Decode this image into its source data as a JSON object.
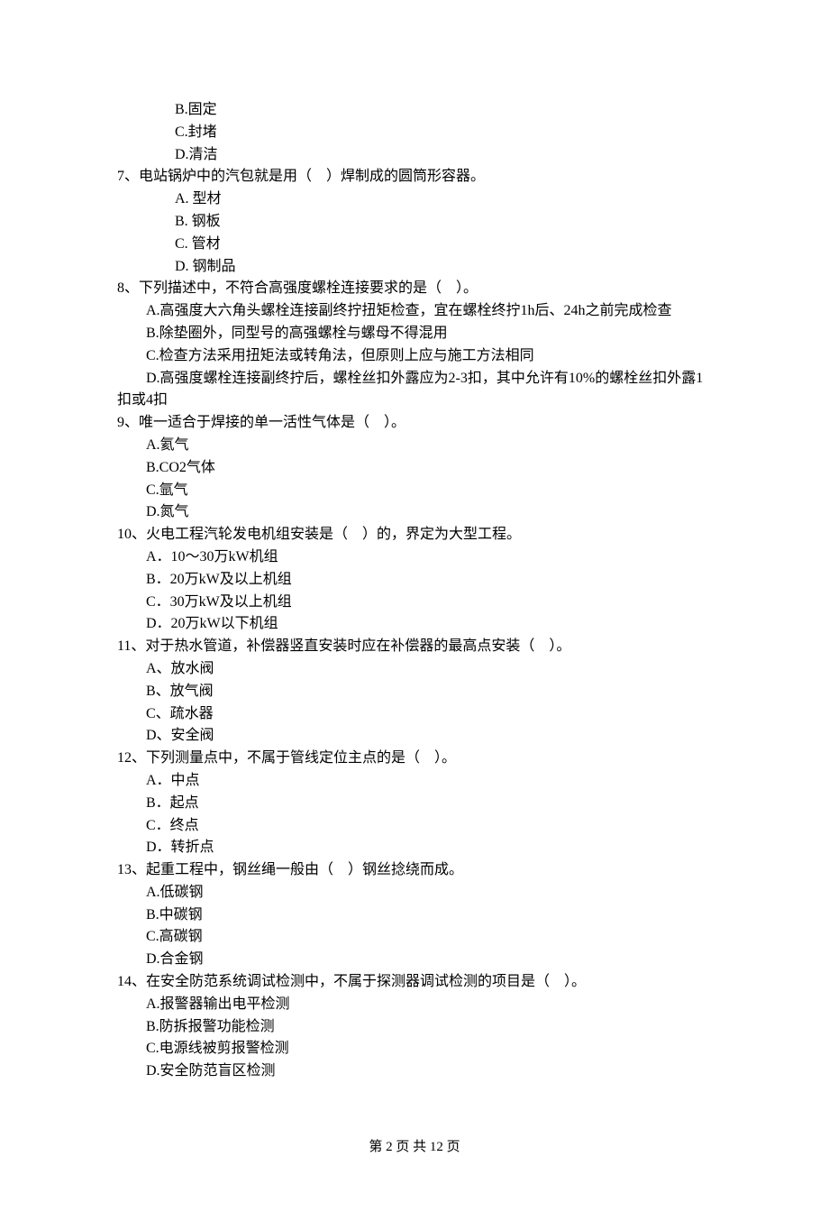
{
  "q6": {
    "opts": {
      "B": "B.固定",
      "C": "C.封堵",
      "D": "D.清洁"
    }
  },
  "q7": {
    "stem": "7、电站锅炉中的汽包就是用（    ）焊制成的圆筒形容器。",
    "opts": {
      "A": "A. 型材",
      "B": "B. 钢板",
      "C": "C. 管材",
      "D": "D. 钢制品"
    }
  },
  "q8": {
    "stem": "8、下列描述中，不符合高强度螺栓连接要求的是（    ）。",
    "opts": {
      "A": "A.高强度大六角头螺栓连接副终拧扭矩检查，宜在螺栓终拧1h后、24h之前完成检查",
      "B": "B.除垫圈外，同型号的高强螺栓与螺母不得混用",
      "C": "C.检查方法采用扭矩法或转角法，但原则上应与施工方法相同",
      "D1": "D.高强度螺栓连接副终拧后，螺栓丝扣外露应为2-3扣，其中允许有10%的螺栓丝扣外露1",
      "D2": "扣或4扣"
    }
  },
  "q9": {
    "stem": "9、唯一适合于焊接的单一活性气体是（    ）。",
    "opts": {
      "A": "A.氦气",
      "B": "B.CO2气体",
      "C": "C.氩气",
      "D": "D.氮气"
    }
  },
  "q10": {
    "stem": "10、火电工程汽轮发电机组安装是（    ）的，界定为大型工程。",
    "opts": {
      "A": "A．10～30万kW机组",
      "B": "B．20万kW及以上机组",
      "C": "C．30万kW及以上机组",
      "D": "D．20万kW以下机组"
    }
  },
  "q11": {
    "stem": "11、对于热水管道，补偿器竖直安装时应在补偿器的最高点安装（    ）。",
    "opts": {
      "A": "A、放水阀",
      "B": "B、放气阀",
      "C": "C、疏水器",
      "D": "D、安全阀"
    }
  },
  "q12": {
    "stem": "12、下列测量点中，不属于管线定位主点的是（    ）。",
    "opts": {
      "A": "A．中点",
      "B": "B．起点",
      "C": "C．终点",
      "D": "D．转折点"
    }
  },
  "q13": {
    "stem": "13、起重工程中，钢丝绳一般由（    ）钢丝捻绕而成。",
    "opts": {
      "A": "A.低碳钢",
      "B": "B.中碳钢",
      "C": "C.高碳钢",
      "D": "D.合金钢"
    }
  },
  "q14": {
    "stem": "14、在安全防范系统调试检测中，不属于探测器调试检测的项目是（    ）。",
    "opts": {
      "A": "A.报警器输出电平检测",
      "B": "B.防拆报警功能检测",
      "C": "C.电源线被剪报警检测",
      "D": "D.安全防范盲区检测"
    }
  },
  "footer": "第 2 页 共 12 页"
}
